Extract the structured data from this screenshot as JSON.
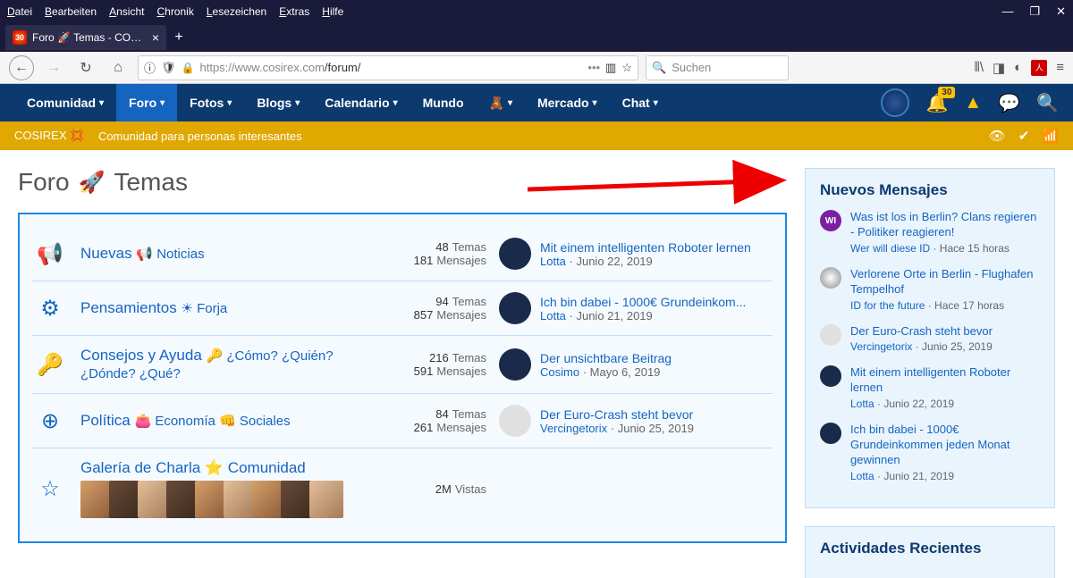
{
  "browser": {
    "menus": [
      "Datei",
      "Bearbeiten",
      "Ansicht",
      "Chronik",
      "Lesezeichen",
      "Extras",
      "Hilfe"
    ],
    "tab_title": "Foro 🚀 Temas - COSIREX 💢",
    "url_host": "https://www.cosirex.com",
    "url_path": "/forum/",
    "search_placeholder": "Suchen"
  },
  "nav": {
    "items": [
      {
        "label": "Comunidad",
        "chev": true
      },
      {
        "label": "Foro",
        "chev": true,
        "active": true
      },
      {
        "label": "Fotos",
        "chev": true
      },
      {
        "label": "Blogs",
        "chev": true
      },
      {
        "label": "Calendario",
        "chev": true
      },
      {
        "label": "Mundo",
        "chev": false
      },
      {
        "label": "🧸",
        "chev": true
      },
      {
        "label": "Mercado",
        "chev": true
      },
      {
        "label": "Chat",
        "chev": true
      }
    ],
    "badge": "30"
  },
  "breadcrumb": {
    "site": "COSIREX 💢",
    "tagline": "Comunidad para personas interesantes"
  },
  "page": {
    "title_a": "Foro",
    "title_b": "Temas"
  },
  "forums": [
    {
      "icon": "📢",
      "name": "Nuevas",
      "sub": "📢 Noticias",
      "temas": "48",
      "mensajes": "181",
      "last": {
        "title": "Mit einem intelligenten Roboter lernen",
        "user": "Lotta",
        "date": "Junio 22, 2019",
        "av": "dark"
      }
    },
    {
      "icon": "⚙",
      "name": "Pensamientos",
      "sub": "☀ Forja",
      "temas": "94",
      "mensajes": "857",
      "last": {
        "title": "Ich bin dabei - 1000€ Grundeinkom...",
        "user": "Lotta",
        "date": "Junio 21, 2019",
        "av": "dark"
      }
    },
    {
      "icon": "🔑",
      "name": "Consejos y Ayuda",
      "sub": "🔑 ¿Cómo? ¿Quién? ¿Dónde? ¿Qué?",
      "temas": "216",
      "mensajes": "591",
      "last": {
        "title": "Der unsichtbare Beitrag",
        "user": "Cosimo",
        "date": "Mayo 6, 2019",
        "av": "dark"
      }
    },
    {
      "icon": "⊕",
      "name": "Política",
      "sub": "👛 Economía 👊 Sociales",
      "temas": "84",
      "mensajes": "261",
      "last": {
        "title": "Der Euro-Crash steht bevor",
        "user": "Vercingetorix",
        "date": "Junio 25, 2019",
        "av": "light"
      }
    },
    {
      "icon": "☆",
      "name": "Galería de Charla",
      "sub": "⭐ Comunidad",
      "vistas": "2M",
      "gallery": true
    }
  ],
  "labels": {
    "temas": "Temas",
    "mensajes": "Mensajes",
    "vistas": "Vistas"
  },
  "widget1": {
    "title": "Nuevos Mensajes",
    "msgs": [
      {
        "av": "wi",
        "avtxt": "WI",
        "title": "Was ist los in Berlin? Clans regieren - Politiker reagieren!",
        "user": "Wer will diese ID",
        "date": "Hace 15 horas"
      },
      {
        "av": "geo",
        "title": "Verlorene Orte in Berlin - Flughafen Tempelhof",
        "user": "ID for the future",
        "date": "Hace 17 horas"
      },
      {
        "av": "ve",
        "title": "Der Euro-Crash steht bevor",
        "user": "Vercingetorix",
        "date": "Junio 25, 2019"
      },
      {
        "av": "dark",
        "title": "Mit einem intelligenten Roboter lernen",
        "user": "Lotta",
        "date": "Junio 22, 2019"
      },
      {
        "av": "dark",
        "title": "Ich bin dabei - 1000€ Grundeinkommen jeden Monat gewinnen",
        "user": "Lotta",
        "date": "Junio 21, 2019"
      }
    ]
  },
  "widget2": {
    "title": "Actividades Recientes"
  }
}
